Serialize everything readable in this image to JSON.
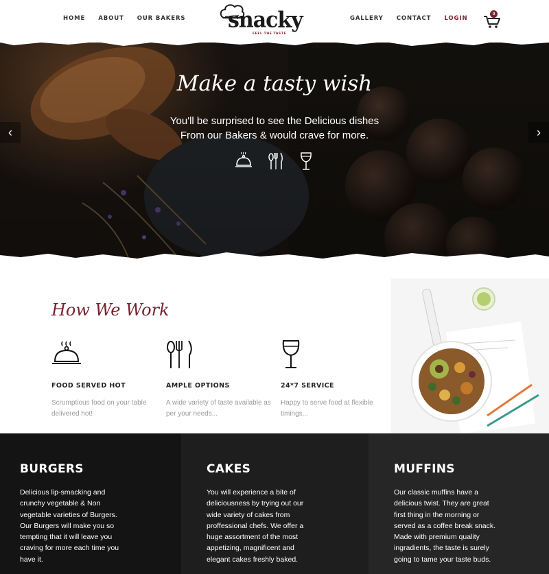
{
  "nav": {
    "left": [
      {
        "label": "HOME"
      },
      {
        "label": "ABOUT"
      },
      {
        "label": "OUR BAKERS"
      }
    ],
    "right": [
      {
        "label": "GALLERY"
      },
      {
        "label": "CONTACT"
      },
      {
        "label": "LOGIN"
      }
    ]
  },
  "logo": {
    "name": "snacky",
    "tagline": "FEEL THE TASTE"
  },
  "cart": {
    "count": "0",
    "icon": "cart-icon"
  },
  "hero": {
    "title": "Make a tasty wish",
    "subtitle_line1": "You'll be surprised to see the Delicious dishes",
    "subtitle_line2": "From our Bakers & would crave for more.",
    "icons": [
      "cloche-icon",
      "cutlery-icon",
      "wine-glass-icon"
    ],
    "prev_icon": "chevron-left-icon",
    "next_icon": "chevron-right-icon"
  },
  "how_we_work": {
    "title": "How We Work",
    "features": [
      {
        "icon": "cloche-icon",
        "title": "FOOD SERVED HOT",
        "desc": "Scrumptious food on your table delivered hot!"
      },
      {
        "icon": "cutlery-icon",
        "title": "AMPLE OPTIONS",
        "desc": "A wide variety of taste available as per your needs..."
      },
      {
        "icon": "wine-glass-icon",
        "title": "24*7 SERVICE",
        "desc": "Happy to serve food at flexible timings..."
      }
    ]
  },
  "categories": [
    {
      "title": "BURGERS",
      "text": "Delicious lip-smacking and crunchy vegetable & Non vegetable varieties of Burgers. Our Burgers will make you so tempting that it will leave you craving for more each time you have it.",
      "bg": "#141414"
    },
    {
      "title": "CAKES",
      "text": "You will experience a bite of deliciousness by trying out our wide variety of cakes from proffessional chefs. We offer a huge assortment of the most appetizing, magnificent and elegant cakes freshly baked.",
      "bg": "#1e1e1e"
    },
    {
      "title": "MUFFINS",
      "text": "Our classic muffins have a delicious twist. They are great first thing in the morning or served as a coffee break snack. Made with premium quality ingradients, the taste is surely going to tame your taste buds.",
      "bg": "#262626"
    }
  ],
  "colors": {
    "accent": "#7a2230",
    "dark": "#141414"
  }
}
